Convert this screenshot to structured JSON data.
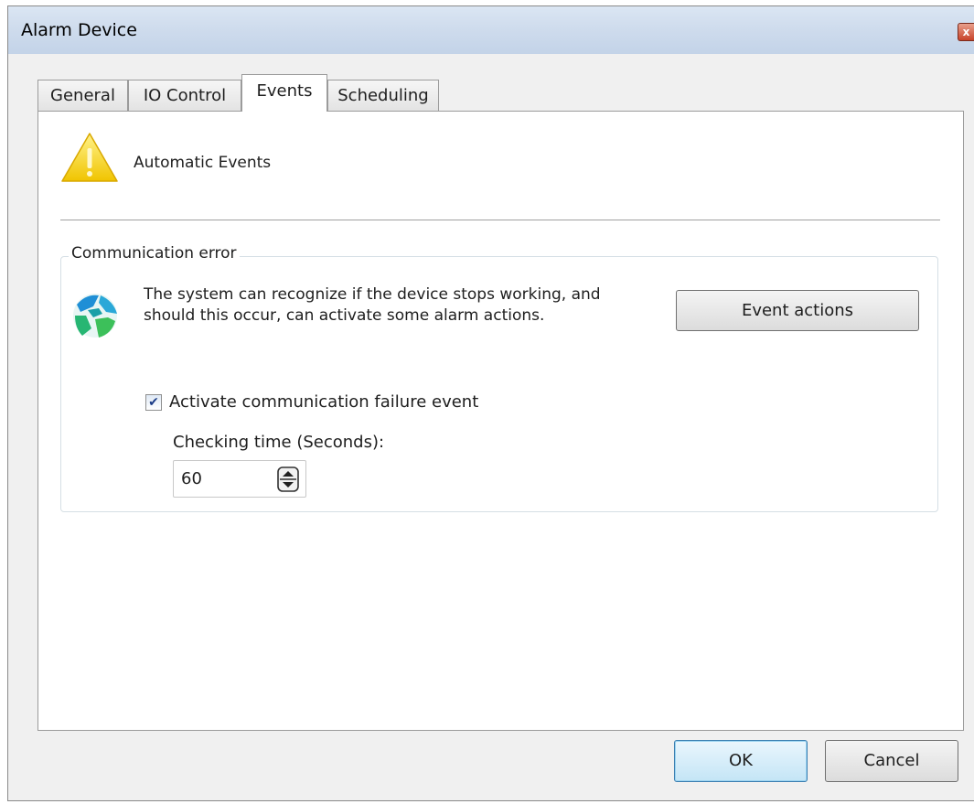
{
  "window": {
    "title": "Alarm Device",
    "close_glyph": "x"
  },
  "tabs": [
    {
      "label": "General"
    },
    {
      "label": "IO Control"
    },
    {
      "label": "Events",
      "active": true
    },
    {
      "label": "Scheduling"
    }
  ],
  "header": {
    "label": "Automatic Events",
    "icon": "warning-icon"
  },
  "comm_group": {
    "title": "Communication error",
    "icon": "globe-icon",
    "description_line1": "The system can recognize if the device stops working, and",
    "description_line2": "should this occur, can activate some alarm actions.",
    "event_actions_label": "Event actions",
    "checkbox_label": "Activate communication failure event",
    "checkbox_checked": true,
    "checking_time_label": "Checking time (Seconds):",
    "checking_time_value": "60"
  },
  "buttons": {
    "ok": "OK",
    "cancel": "Cancel"
  },
  "colors": {
    "accent": "#3c7fb1",
    "warning": "#f5c800"
  }
}
